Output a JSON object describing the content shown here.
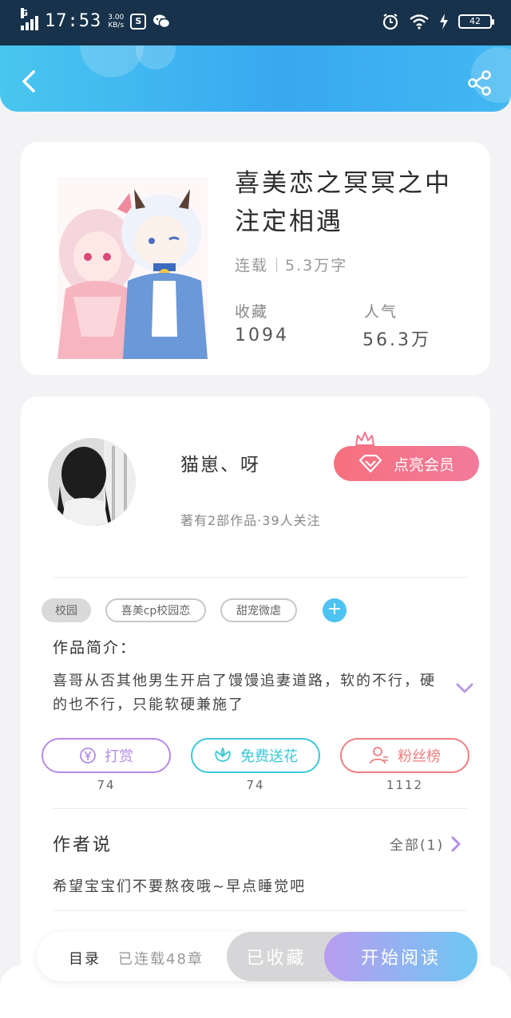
{
  "status_bar": {
    "network": "G",
    "time": "17:53",
    "speed_value": "3.00",
    "speed_unit": "KB/s",
    "battery": "42"
  },
  "header": {
    "back_icon": "chevron-left-icon",
    "share_icon": "share-icon"
  },
  "book": {
    "title": "喜美恋之冥冥之中注定相遇",
    "status": "连载",
    "word_count": "5.3万字",
    "favorites_label": "收藏",
    "favorites_value": "1094",
    "popularity_label": "人气",
    "popularity_value": "56.3万"
  },
  "author": {
    "name": "猫崽、呀",
    "summary": "著有2部作品·39人关注",
    "vip_button": "点亮会员"
  },
  "tags": [
    "校园",
    "喜美cp校园恋",
    "甜宠微虐"
  ],
  "intro": {
    "title": "作品简介：",
    "text": "喜哥从否其他男生开启了馒馒追妻道路，软的不行，硬的也不行，只能软硬兼施了"
  },
  "actions": [
    {
      "label": "打赏",
      "count": "74",
      "color": "#b48be6"
    },
    {
      "label": "免费送花",
      "count": "74",
      "color": "#3cc7d9"
    },
    {
      "label": "粉丝榜",
      "count": "1112",
      "color": "#ef7f7f"
    }
  ],
  "author_says": {
    "title": "作者说",
    "all_label": "全部(1)",
    "text": "希望宝宝们不要熬夜哦~早点睡觉吧"
  },
  "bottom_bar": {
    "toc_label": "目录",
    "toc_count": "已连载48章",
    "collected_label": "已收藏",
    "read_label": "开始阅读"
  }
}
